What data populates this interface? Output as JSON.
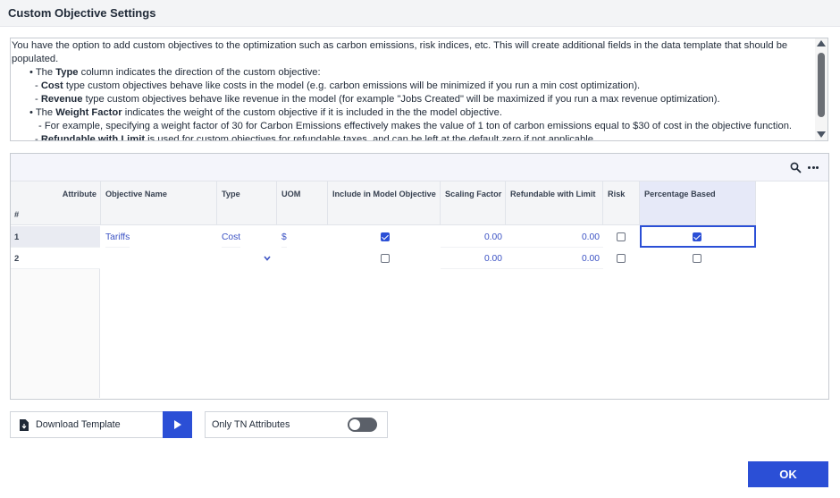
{
  "dialog": {
    "title": "Custom Objective Settings"
  },
  "info": {
    "intro": "You have the option to add custom objectives to the optimization such as carbon emissions, risk indices, etc. This will create additional fields in the data template that should be populated.",
    "bullet_type_pre": "• The ",
    "bullet_type_bold": "Type",
    "bullet_type_post": " column indicates the direction of the custom objective:",
    "cost_pre": "- ",
    "cost_bold": "Cost",
    "cost_post": " type custom objectives behave like costs in the model (e.g. carbon emissions will be minimized if you run a min cost optimization).",
    "revenue_pre": "- ",
    "revenue_bold": "Revenue",
    "revenue_post": " type custom objectives behave like revenue in the model (for example \"Jobs Created\" will be maximized if you run a max revenue optimization).",
    "weight_pre": "• The ",
    "weight_bold": "Weight Factor",
    "weight_post": " indicates the weight of the custom objective if it is included in the the model objective.",
    "weight_example": "- For example, specifying a weight factor of 30 for Carbon Emissions effectively makes the value of 1 ton of carbon emissions equal to $30 of cost in the objective function.",
    "refund_pre": "- ",
    "refund_bold": "Refundable with Limit",
    "refund_post": " is used for custom objectives for refundable taxes, and can be left at the default zero if not applicable."
  },
  "grid": {
    "columns": {
      "attribute": "Attribute",
      "row_number": "#",
      "objective_name": "Objective Name",
      "type": "Type",
      "uom": "UOM",
      "include": "Include in Model Objective",
      "scaling": "Scaling Factor",
      "refundable": "Refundable with Limit",
      "risk": "Risk",
      "percentage": "Percentage Based"
    },
    "rows": [
      {
        "num": "1",
        "objective_name": "Tariffs",
        "type": "Cost",
        "uom": "$",
        "include": true,
        "scaling": "0.00",
        "refundable": "0.00",
        "risk": false,
        "percentage": true
      },
      {
        "num": "2",
        "objective_name": "",
        "type": "",
        "uom": "",
        "include": false,
        "scaling": "0.00",
        "refundable": "0.00",
        "risk": false,
        "percentage": false
      }
    ]
  },
  "footer": {
    "download_label": "Download Template",
    "only_tn_label": "Only TN Attributes",
    "only_tn_on": false,
    "ok_label": "OK"
  },
  "colors": {
    "accent": "#2b4fd6",
    "link_text": "#3b52c4"
  }
}
